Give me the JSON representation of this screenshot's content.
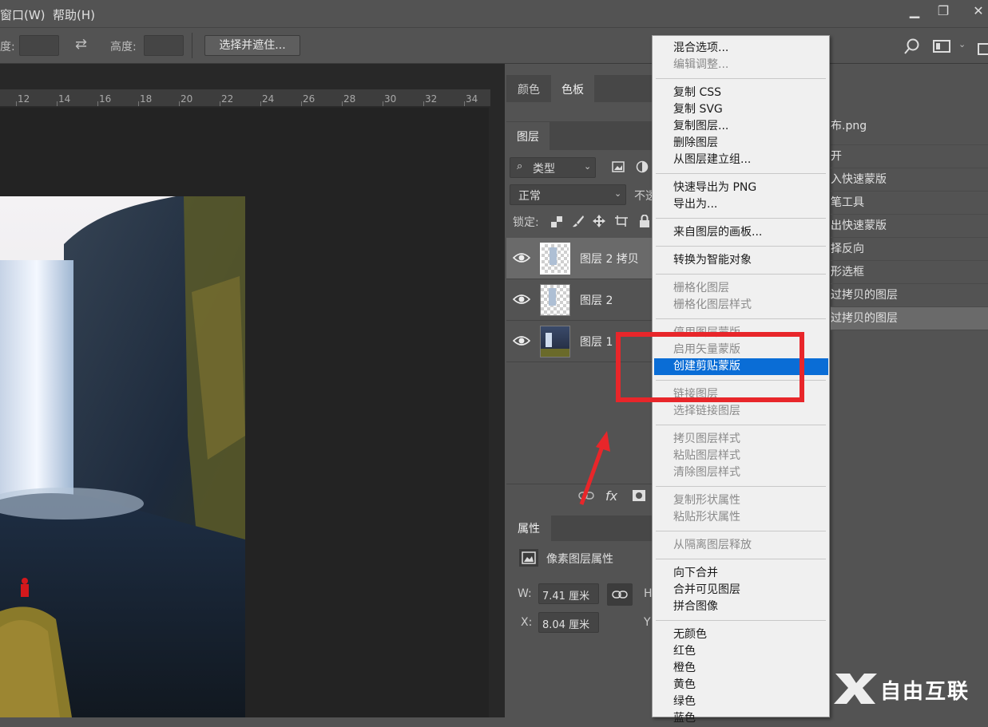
{
  "menubar": {
    "window_menu": "窗口(W)",
    "help_menu": "帮助(H)"
  },
  "options": {
    "width_label": "宽度:",
    "height_label": "高度:",
    "select_mask_button": "选择并遮住..."
  },
  "ruler": {
    "ticks": [
      "12",
      "14",
      "16",
      "18",
      "20",
      "22",
      "24",
      "26",
      "28",
      "30",
      "32",
      "34"
    ]
  },
  "tabs": {
    "color": "颜色",
    "swatches": "色板",
    "layers": "图层",
    "properties": "属性"
  },
  "layers_panel": {
    "filter_kind": "类型",
    "blend_mode": "正常",
    "opacity_label": "不透",
    "lock_label": "锁定:",
    "layers": [
      {
        "name": "图层 2 拷贝"
      },
      {
        "name": "图层 2"
      },
      {
        "name": "图层 1"
      }
    ],
    "fx_label": "fx"
  },
  "properties_panel": {
    "title": "像素图层属性",
    "w_label": "W:",
    "w_value": "7.41 厘米",
    "x_label": "X:",
    "x_value": "8.04 厘米",
    "h_label": "H",
    "y_label": "Y"
  },
  "history": {
    "doc_name": "布.png",
    "items": [
      "开",
      "入快速蒙版",
      "笔工具",
      "出快速蒙版",
      "择反向",
      "形选框",
      "过拷贝的图层",
      "过拷贝的图层"
    ]
  },
  "context_menu": {
    "groups": [
      [
        {
          "label": "混合选项...",
          "enabled": true
        },
        {
          "label": "编辑调整...",
          "enabled": false
        }
      ],
      [
        {
          "label": "复制 CSS",
          "enabled": true
        },
        {
          "label": "复制 SVG",
          "enabled": true
        },
        {
          "label": "复制图层...",
          "enabled": true
        },
        {
          "label": "删除图层",
          "enabled": true
        },
        {
          "label": "从图层建立组...",
          "enabled": true
        }
      ],
      [
        {
          "label": "快速导出为 PNG",
          "enabled": true
        },
        {
          "label": "导出为...",
          "enabled": true
        }
      ],
      [
        {
          "label": "来自图层的画板...",
          "enabled": true
        }
      ],
      [
        {
          "label": "转换为智能对象",
          "enabled": true
        }
      ],
      [
        {
          "label": "栅格化图层",
          "enabled": false
        },
        {
          "label": "栅格化图层样式",
          "enabled": false
        }
      ],
      [
        {
          "label": "停用图层蒙版",
          "enabled": false
        },
        {
          "label": "启用矢量蒙版",
          "enabled": false
        },
        {
          "label": "创建剪贴蒙版",
          "enabled": true,
          "highlighted": true
        }
      ],
      [
        {
          "label": "链接图层",
          "enabled": false
        },
        {
          "label": "选择链接图层",
          "enabled": false
        }
      ],
      [
        {
          "label": "拷贝图层样式",
          "enabled": false
        },
        {
          "label": "粘贴图层样式",
          "enabled": false
        },
        {
          "label": "清除图层样式",
          "enabled": false
        }
      ],
      [
        {
          "label": "复制形状属性",
          "enabled": false
        },
        {
          "label": "粘贴形状属性",
          "enabled": false
        }
      ],
      [
        {
          "label": "从隔离图层释放",
          "enabled": false
        }
      ],
      [
        {
          "label": "向下合并",
          "enabled": true
        },
        {
          "label": "合并可见图层",
          "enabled": true
        },
        {
          "label": "拼合图像",
          "enabled": true
        }
      ],
      [
        {
          "label": "无颜色",
          "enabled": true
        },
        {
          "label": "红色",
          "enabled": true
        },
        {
          "label": "橙色",
          "enabled": true
        },
        {
          "label": "黄色",
          "enabled": true
        },
        {
          "label": "绿色",
          "enabled": true
        },
        {
          "label": "蓝色",
          "enabled": true
        }
      ]
    ]
  },
  "watermark": {
    "text": "自由互联"
  },
  "colors": {
    "highlight": "#0a6dd6",
    "annotation_red": "#e8262a"
  }
}
